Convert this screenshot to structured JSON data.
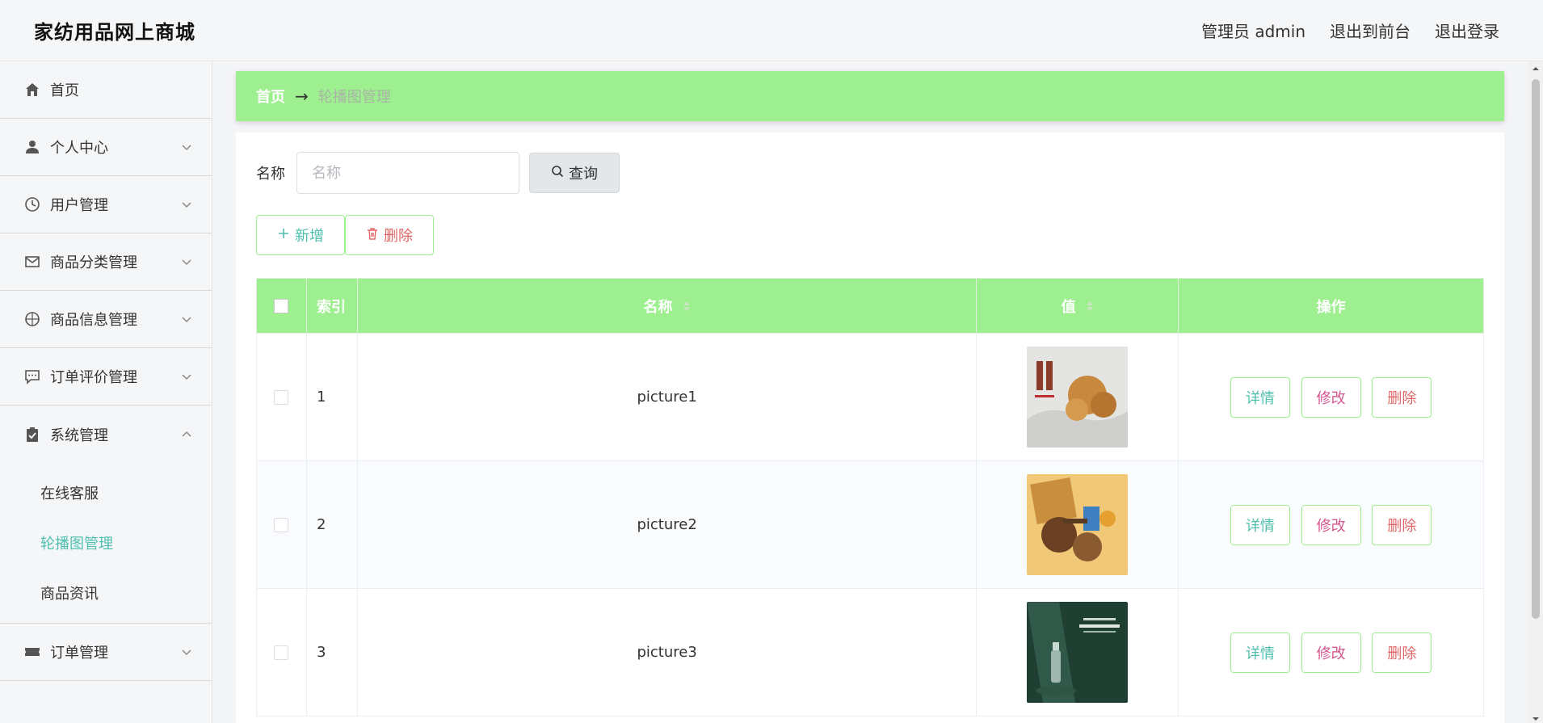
{
  "header": {
    "brand": "家纺用品网上商城",
    "user_label": "管理员 admin",
    "front_link": "退出到前台",
    "logout_link": "退出登录"
  },
  "sidebar": {
    "items": [
      {
        "label": "首页",
        "icon": "home-icon"
      },
      {
        "label": "个人中心",
        "icon": "user-icon"
      },
      {
        "label": "用户管理",
        "icon": "clock-icon"
      },
      {
        "label": "商品分类管理",
        "icon": "mail-icon"
      },
      {
        "label": "商品信息管理",
        "icon": "compass-icon"
      },
      {
        "label": "订单评价管理",
        "icon": "chat-icon"
      },
      {
        "label": "系统管理",
        "icon": "clipboard-icon"
      },
      {
        "label": "订单管理",
        "icon": "ticket-icon"
      }
    ],
    "system_sub": [
      {
        "label": "在线客服"
      },
      {
        "label": "轮播图管理"
      },
      {
        "label": "商品资讯"
      }
    ]
  },
  "breadcrumb": {
    "home": "首页",
    "separator": "→",
    "current": "轮播图管理"
  },
  "search": {
    "label": "名称",
    "placeholder": "名称",
    "button": "查询"
  },
  "actions": {
    "add": "新增",
    "delete": "删除"
  },
  "table": {
    "headers": {
      "index": "索引",
      "name": "名称",
      "value": "值",
      "ops": "操作"
    },
    "rows": [
      {
        "index": "1",
        "name": "picture1",
        "image": "walnut-banner"
      },
      {
        "index": "2",
        "name": "picture2",
        "image": "snack-banner"
      },
      {
        "index": "3",
        "name": "picture3",
        "image": "cosmetic-banner"
      }
    ],
    "row_actions": {
      "detail": "详情",
      "edit": "修改",
      "delete": "删除"
    }
  },
  "colors": {
    "accent_green": "#9def8f",
    "teal": "#4fbfae",
    "pink": "#d4568f",
    "red": "#e06666"
  }
}
